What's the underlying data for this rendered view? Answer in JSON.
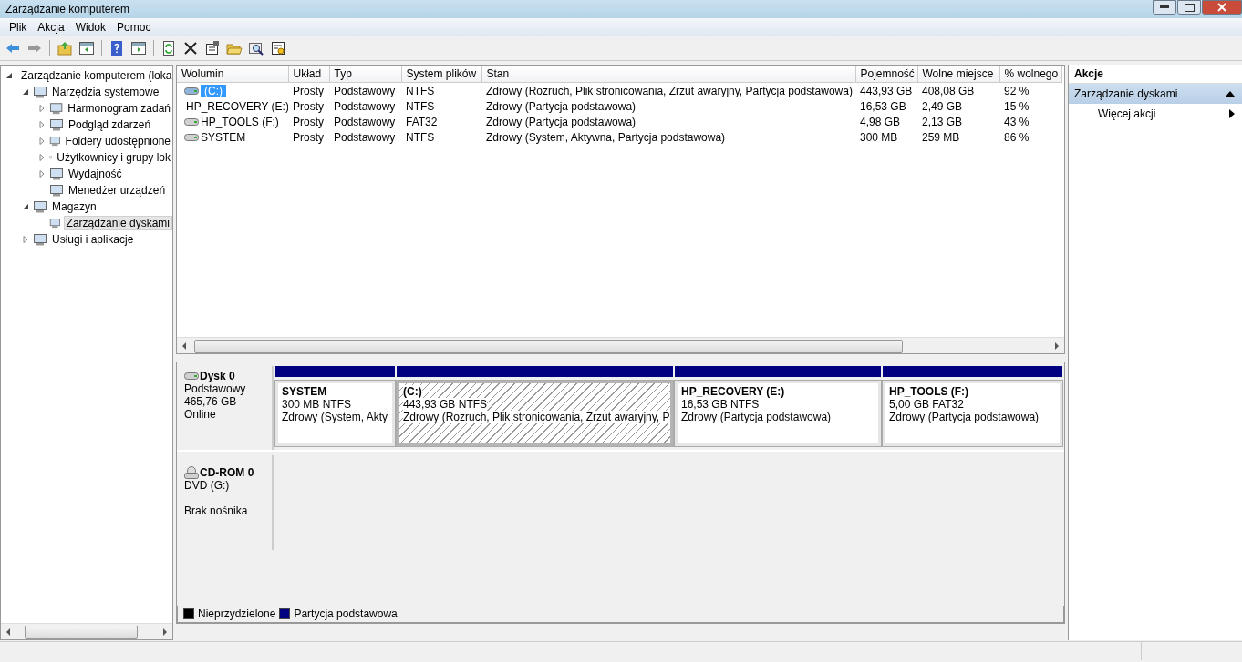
{
  "window": {
    "title": "Zarządzanie komputerem"
  },
  "menu": [
    "Plik",
    "Akcja",
    "Widok",
    "Pomoc"
  ],
  "tree": [
    {
      "label": "Zarządzanie komputerem (loka",
      "expanded": true,
      "selected": false,
      "children": [
        {
          "label": "Narzędzia systemowe",
          "expanded": true,
          "selected": false,
          "children": [
            {
              "label": "Harmonogram zadań",
              "expanded": false,
              "selected": false
            },
            {
              "label": "Podgląd zdarzeń",
              "expanded": false,
              "selected": false
            },
            {
              "label": "Foldery udostępnione",
              "expanded": false,
              "selected": false
            },
            {
              "label": "Użytkownicy i grupy lok",
              "expanded": false,
              "selected": false
            },
            {
              "label": "Wydajność",
              "expanded": false,
              "selected": false
            },
            {
              "label": "Menedżer urządzeń",
              "selected": false
            }
          ]
        },
        {
          "label": "Magazyn",
          "expanded": true,
          "selected": false,
          "children": [
            {
              "label": "Zarządzanie dyskami",
              "selected": true
            }
          ]
        },
        {
          "label": "Usługi i aplikacje",
          "expanded": false,
          "selected": false
        }
      ]
    }
  ],
  "table": {
    "columns": [
      "Wolumin",
      "Układ",
      "Typ",
      "System plików",
      "Stan",
      "Pojemność",
      "Wolne miejsce",
      "% wolnego"
    ],
    "rows": [
      {
        "selected": true,
        "cells": [
          "(C:)",
          "Prosty",
          "Podstawowy",
          "NTFS",
          "Zdrowy (Rozruch, Plik stronicowania, Zrzut awaryjny, Partycja podstawowa)",
          "443,93 GB",
          "408,08 GB",
          "92 %"
        ]
      },
      {
        "selected": false,
        "cells": [
          "HP_RECOVERY (E:)",
          "Prosty",
          "Podstawowy",
          "NTFS",
          "Zdrowy (Partycja podstawowa)",
          "16,53 GB",
          "2,49 GB",
          "15 %"
        ]
      },
      {
        "selected": false,
        "cells": [
          "HP_TOOLS (F:)",
          "Prosty",
          "Podstawowy",
          "FAT32",
          "Zdrowy (Partycja podstawowa)",
          "4,98 GB",
          "2,13 GB",
          "43 %"
        ]
      },
      {
        "selected": false,
        "cells": [
          "SYSTEM",
          "Prosty",
          "Podstawowy",
          "NTFS",
          "Zdrowy (System, Aktywna, Partycja podstawowa)",
          "300 MB",
          "259 MB",
          "86 %"
        ]
      }
    ]
  },
  "disks": [
    {
      "kind": "disk",
      "name": "Dysk 0",
      "type": "Podstawowy",
      "size": "465,76 GB",
      "status": "Online",
      "partitions": [
        {
          "name": "SYSTEM",
          "size": "300 MB NTFS",
          "status": "Zdrowy (System, Akty",
          "selected": false
        },
        {
          "name": "(C:)",
          "size": "443,93 GB NTFS",
          "status": "Zdrowy (Rozruch, Plik stronicowania, Zrzut awaryjny, P",
          "selected": true
        },
        {
          "name": "HP_RECOVERY  (E:)",
          "size": "16,53 GB NTFS",
          "status": "Zdrowy (Partycja podstawowa)",
          "selected": false
        },
        {
          "name": "HP_TOOLS  (F:)",
          "size": "5,00 GB FAT32",
          "status": "Zdrowy (Partycja podstawowa)",
          "selected": false
        }
      ]
    },
    {
      "kind": "cdrom",
      "name": "CD-ROM 0",
      "type": "DVD (G:)",
      "status": "Brak nośnika"
    }
  ],
  "legend": [
    {
      "label": "Nieprzydzielone",
      "color": "#000000"
    },
    {
      "label": "Partycja podstawowa",
      "color": "#000080"
    }
  ],
  "actions": {
    "title": "Akcje",
    "section": "Zarządzanie dyskami",
    "items": [
      "Więcej akcji"
    ]
  }
}
